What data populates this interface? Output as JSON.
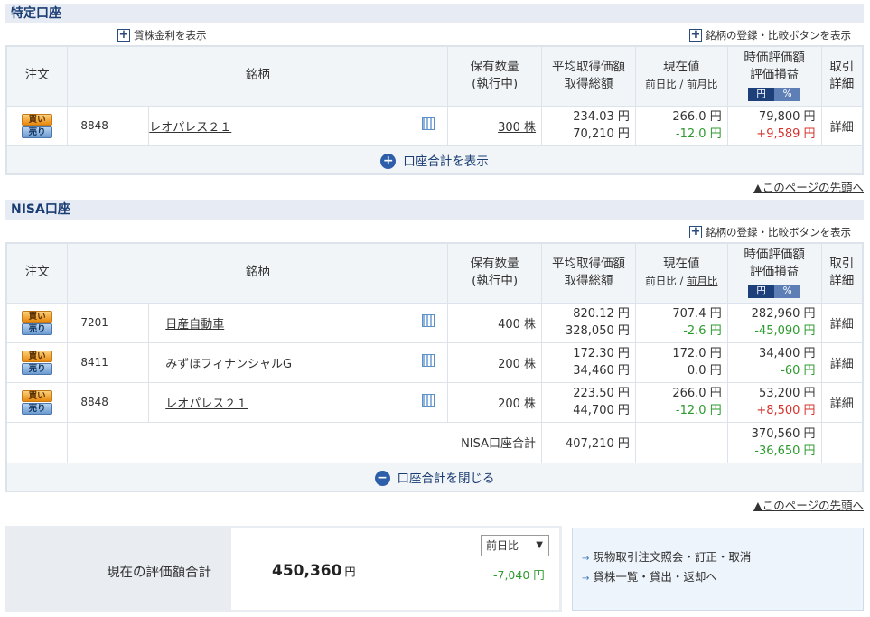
{
  "tokutei": {
    "title": "特定口座",
    "link_left": "貸株金利を表示",
    "link_right": "銘柄の登録・比較ボタンを表示",
    "headers": {
      "order": "注文",
      "name": "銘柄",
      "qty_line1": "保有数量",
      "qty_line2": "(執行中)",
      "avg_line1": "平均取得価額",
      "avg_line2": "取得総額",
      "price_line1": "現在値",
      "price_prev_day": "前日比",
      "price_sep": " / ",
      "price_prev_month": "前月比",
      "eval_line1": "時価評価額",
      "eval_line2": "評価損益",
      "toggle_yen": "円",
      "toggle_pct": "%",
      "trade_line1": "取引",
      "trade_line2": "詳細"
    },
    "rows": [
      {
        "buy": "買い",
        "sell": "売り",
        "code": "8848",
        "name": "レオパレス２１",
        "qty": "300 株",
        "avg_price": "234.03 円",
        "total_cost": "70,210 円",
        "price": "266.0 円",
        "change": "-12.0 円",
        "value": "79,800 円",
        "pl": "+9,589 円",
        "detail": "詳細"
      }
    ],
    "toggle": "口座合計を表示",
    "toggle_symbol": "+",
    "pagetop": "▲このページの先頭へ"
  },
  "nisa": {
    "title": "NISA口座",
    "link_right": "銘柄の登録・比較ボタンを表示",
    "rows": [
      {
        "buy": "買い",
        "sell": "売り",
        "code": "7201",
        "name": "日産自動車",
        "qty": "400 株",
        "avg_price": "820.12 円",
        "total_cost": "328,050 円",
        "price": "707.4 円",
        "change": "-2.6 円",
        "value": "282,960 円",
        "pl": "-45,090 円",
        "detail": "詳細"
      },
      {
        "buy": "買い",
        "sell": "売り",
        "code": "8411",
        "name": "みずほフィナンシャルG",
        "qty": "200 株",
        "avg_price": "172.30 円",
        "total_cost": "34,460 円",
        "price": "172.0 円",
        "change": "0.0 円",
        "value": "34,400 円",
        "pl": "-60 円",
        "detail": "詳細"
      },
      {
        "buy": "買い",
        "sell": "売り",
        "code": "8848",
        "name": "レオパレス２１",
        "qty": "200 株",
        "avg_price": "223.50 円",
        "total_cost": "44,700 円",
        "price": "266.0 円",
        "change": "-12.0 円",
        "value": "53,200 円",
        "pl": "+8,500 円",
        "detail": "詳細"
      }
    ],
    "total": {
      "label": "NISA口座合計",
      "cost": "407,210 円",
      "value": "370,560 円",
      "pl": "-36,650 円"
    },
    "toggle": "口座合計を閉じる",
    "toggle_symbol": "−",
    "pagetop": "▲このページの先頭へ"
  },
  "summary": {
    "label": "現在の評価額合計",
    "value": "450,360",
    "yen": "円",
    "select_value": "前日比",
    "diff": "-7,040 円"
  },
  "links": {
    "items": [
      "現物取引注文照会・訂正・取消",
      "貸株一覧・貸出・返却へ"
    ]
  }
}
